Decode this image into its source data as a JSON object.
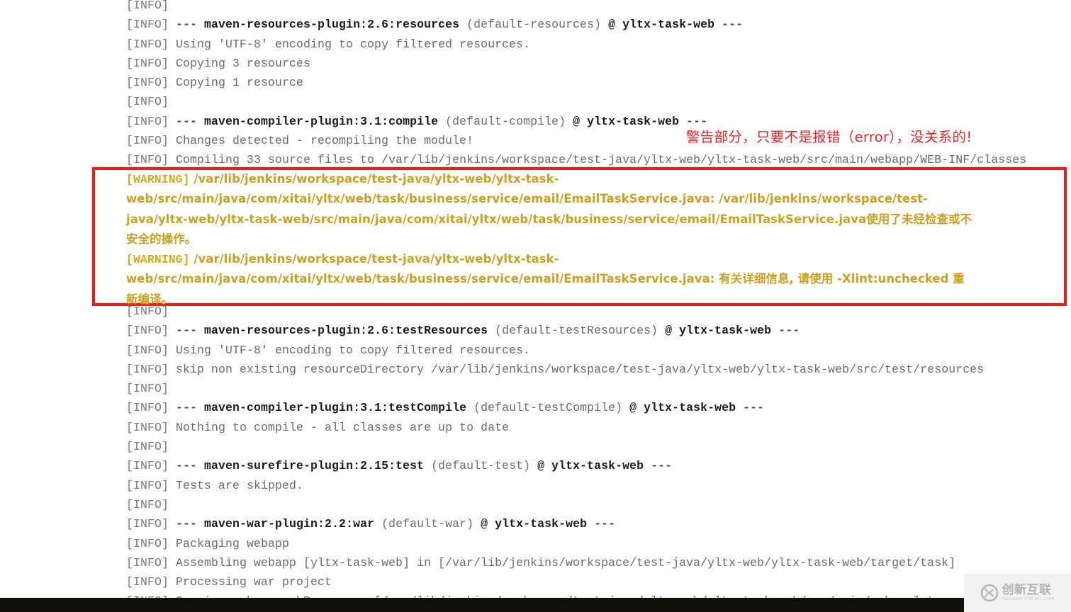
{
  "console": {
    "name": "jenkins-maven-console-output",
    "lines": [
      {
        "tag": "[INFO]",
        "text": ""
      },
      {
        "tag": "[INFO]",
        "dash": "---",
        "goal": "maven-resources-plugin:2.6:resources",
        "rest": " (default-resources) ",
        "at": "@ yltx-task-web",
        "tail": " ---"
      },
      {
        "tag": "[INFO]",
        "text": "Using 'UTF-8' encoding to copy filtered resources."
      },
      {
        "tag": "[INFO]",
        "text": "Copying 3 resources"
      },
      {
        "tag": "[INFO]",
        "text": "Copying 1 resource"
      },
      {
        "tag": "[INFO]",
        "text": ""
      },
      {
        "tag": "[INFO]",
        "dash": "---",
        "goal": "maven-compiler-plugin:3.1:compile",
        "rest": " (default-compile) ",
        "at": "@ yltx-task-web",
        "tail": " ---"
      },
      {
        "tag": "[INFO]",
        "text": "Changes detected - recompiling the module!"
      },
      {
        "tag": "[INFO]",
        "text": "Compiling 33 source files to /var/lib/jenkins/workspace/test-java/yltx-web/yltx-task-web/src/main/webapp/WEB-INF/classes"
      }
    ],
    "lines_after": [
      {
        "tag": "[INFO]",
        "text": ""
      },
      {
        "tag": "[INFO]",
        "dash": "---",
        "goal": "maven-resources-plugin:2.6:testResources",
        "rest": " (default-testResources) ",
        "at": "@ yltx-task-web",
        "tail": " ---"
      },
      {
        "tag": "[INFO]",
        "text": "Using 'UTF-8' encoding to copy filtered resources."
      },
      {
        "tag": "[INFO]",
        "text": "skip non existing resourceDirectory /var/lib/jenkins/workspace/test-java/yltx-web/yltx-task-web/src/test/resources"
      },
      {
        "tag": "[INFO]",
        "text": ""
      },
      {
        "tag": "[INFO]",
        "dash": "---",
        "goal": "maven-compiler-plugin:3.1:testCompile",
        "rest": " (default-testCompile) ",
        "at": "@ yltx-task-web",
        "tail": " ---"
      },
      {
        "tag": "[INFO]",
        "text": "Nothing to compile - all classes are up to date"
      },
      {
        "tag": "[INFO]",
        "text": ""
      },
      {
        "tag": "[INFO]",
        "dash": "---",
        "goal": "maven-surefire-plugin:2.15:test",
        "rest": " (default-test) ",
        "at": "@ yltx-task-web",
        "tail": " ---"
      },
      {
        "tag": "[INFO]",
        "text": "Tests are skipped."
      },
      {
        "tag": "[INFO]",
        "text": ""
      },
      {
        "tag": "[INFO]",
        "dash": "---",
        "goal": "maven-war-plugin:2.2:war",
        "rest": " (default-war) ",
        "at": "@ yltx-task-web",
        "tail": " ---"
      },
      {
        "tag": "[INFO]",
        "text": "Packaging webapp"
      },
      {
        "tag": "[INFO]",
        "text": "Assembling webapp [yltx-task-web] in [/var/lib/jenkins/workspace/test-java/yltx-web/yltx-task-web/target/task]"
      },
      {
        "tag": "[INFO]",
        "text": "Processing war project"
      },
      {
        "tag": "[INFO]",
        "text": "Copying webapp webResources [/var/lib/jenkins/workspace/test-java/yltx-web/yltx-task-web/src/main/webapp] to"
      }
    ]
  },
  "warning_block": {
    "name": "maven-warning-block",
    "border_color": "#f01c1c",
    "text_color": "#cda01f",
    "warnings": [
      {
        "tag": "[WARNING]",
        "line1": " /var/lib/jenkins/workspace/test-java/yltx-web/yltx-task-",
        "line2": "web/src/main/java/com/xitai/yltx/web/task/business/service/email/EmailTaskService.java: /var/lib/jenkins/workspace/test-",
        "line3": "java/yltx-web/yltx-task-web/src/main/java/com/xitai/yltx/web/task/business/service/email/EmailTaskService.java使用了未经检查或不",
        "line4": "安全的操作。"
      },
      {
        "tag": "[WARNING]",
        "line1": " /var/lib/jenkins/workspace/test-java/yltx-web/yltx-task-",
        "line2": "web/src/main/java/com/xitai/yltx/web/task/business/service/email/EmailTaskService.java: 有关详细信息, 请使用 -Xlint:unchecked 重",
        "line3": "新编译。"
      }
    ]
  },
  "annotation": {
    "name": "red-chinese-annotation",
    "text": "警告部分，只要不是报错（error），没关系的!",
    "color": "#ee2424"
  },
  "watermark": {
    "name": "site-watermark",
    "icon": "cx-logo-icon",
    "cn": "创新互联",
    "en": "CHUANG XIN HU LIAN"
  }
}
